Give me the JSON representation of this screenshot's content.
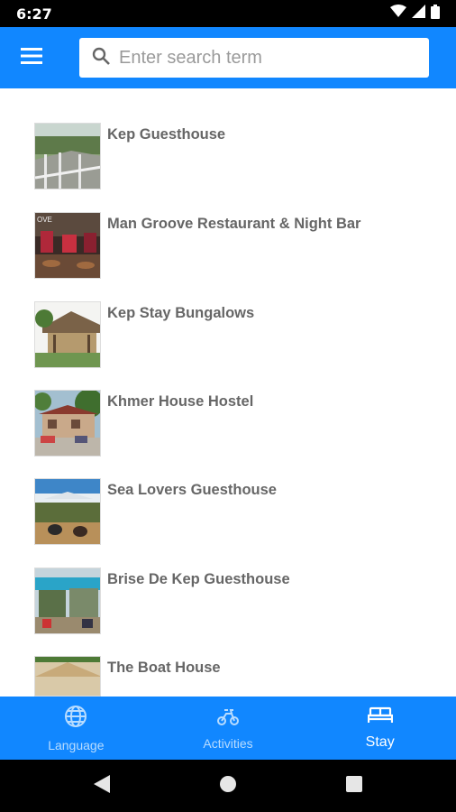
{
  "status_bar": {
    "time": "6:27",
    "icons": [
      "wifi-icon",
      "cell-signal-icon",
      "battery-icon"
    ]
  },
  "app_bar": {
    "menu_icon": "hamburger-menu-icon",
    "search": {
      "icon": "search-icon",
      "placeholder": "Enter search term",
      "value": ""
    }
  },
  "listings": [
    {
      "name": "Kep Guesthouse",
      "thumbnail": "photo"
    },
    {
      "name": "Man Groove Restaurant & Night Bar",
      "thumbnail": "photo"
    },
    {
      "name": "Kep Stay Bungalows",
      "thumbnail": "photo"
    },
    {
      "name": "Khmer House Hostel",
      "thumbnail": "photo"
    },
    {
      "name": "Sea Lovers Guesthouse",
      "thumbnail": "photo"
    },
    {
      "name": "Brise De Kep Guesthouse",
      "thumbnail": "photo"
    },
    {
      "name": "The Boat House",
      "thumbnail": "photo"
    }
  ],
  "bottom_nav": {
    "items": [
      {
        "label": "Language",
        "icon": "globe-icon",
        "active": false
      },
      {
        "label": "Activities",
        "icon": "activities-icon",
        "active": false
      },
      {
        "label": "Stay",
        "icon": "bed-icon",
        "active": true
      }
    ]
  },
  "system_nav": [
    "back-icon",
    "home-icon",
    "recents-icon"
  ],
  "colors": {
    "primary": "#1187ff",
    "title_text": "#666666",
    "inactive_nav": "#b8dcff"
  }
}
